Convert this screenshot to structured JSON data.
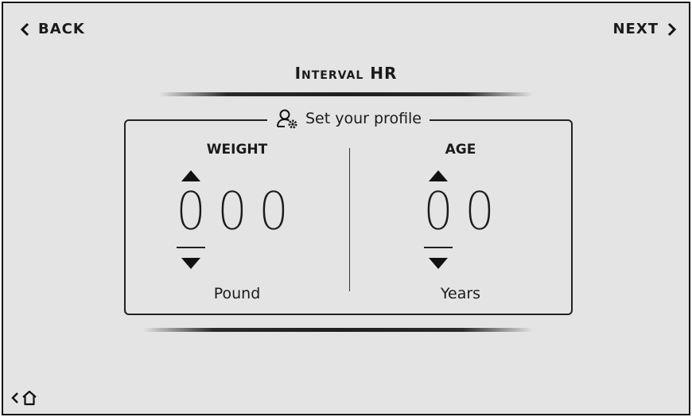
{
  "nav": {
    "back_label": "BACK",
    "next_label": "NEXT"
  },
  "header": {
    "title": "Interval HR"
  },
  "profile": {
    "legend": "Set your profile",
    "weight": {
      "label": "WEIGHT",
      "digits": [
        "0",
        "0",
        "0"
      ],
      "unit": "Pound"
    },
    "age": {
      "label": "AGE",
      "digits": [
        "0",
        "0"
      ],
      "unit": "Years"
    }
  },
  "footer": {
    "icon": "home-icon"
  }
}
